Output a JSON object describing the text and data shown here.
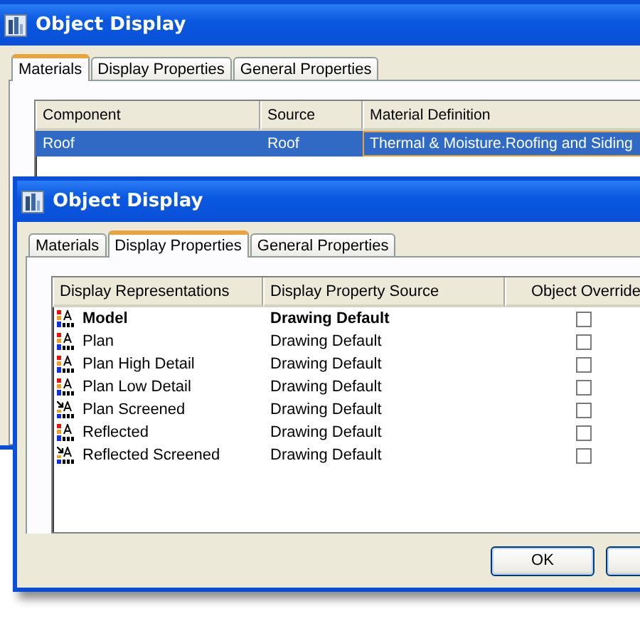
{
  "windows": [
    {
      "title": "Object Display",
      "tabs": [
        {
          "label": "Materials",
          "selected": true
        },
        {
          "label": "Display Properties",
          "selected": false
        },
        {
          "label": "General Properties",
          "selected": false
        }
      ],
      "table": {
        "columns": [
          "Component",
          "Source",
          "Material Definition"
        ],
        "rows": [
          {
            "cells": [
              "Roof",
              "Roof",
              "Thermal & Moisture.Roofing and Siding"
            ],
            "selected": true
          }
        ]
      }
    },
    {
      "title": "Object Display",
      "tabs": [
        {
          "label": "Materials",
          "selected": false
        },
        {
          "label": "Display Properties",
          "selected": true
        },
        {
          "label": "General Properties",
          "selected": false
        }
      ],
      "table": {
        "columns": [
          "Display Representations",
          "Display Property Source",
          "Object Override"
        ],
        "rows": [
          {
            "kind": "normal",
            "name": "Model",
            "source": "Drawing Default",
            "current": true,
            "checked": false
          },
          {
            "kind": "normal",
            "name": "Plan",
            "source": "Drawing Default",
            "current": false,
            "checked": false
          },
          {
            "kind": "normal",
            "name": "Plan High Detail",
            "source": "Drawing Default",
            "current": false,
            "checked": false
          },
          {
            "kind": "normal",
            "name": "Plan Low Detail",
            "source": "Drawing Default",
            "current": false,
            "checked": false
          },
          {
            "kind": "screened",
            "name": "Plan Screened",
            "source": "Drawing Default",
            "current": false,
            "checked": false
          },
          {
            "kind": "normal",
            "name": "Reflected",
            "source": "Drawing Default",
            "current": false,
            "checked": false
          },
          {
            "kind": "screened",
            "name": "Reflected Screened",
            "source": "Drawing Default",
            "current": false,
            "checked": false
          }
        ]
      },
      "buttons": [
        "OK"
      ]
    }
  ]
}
